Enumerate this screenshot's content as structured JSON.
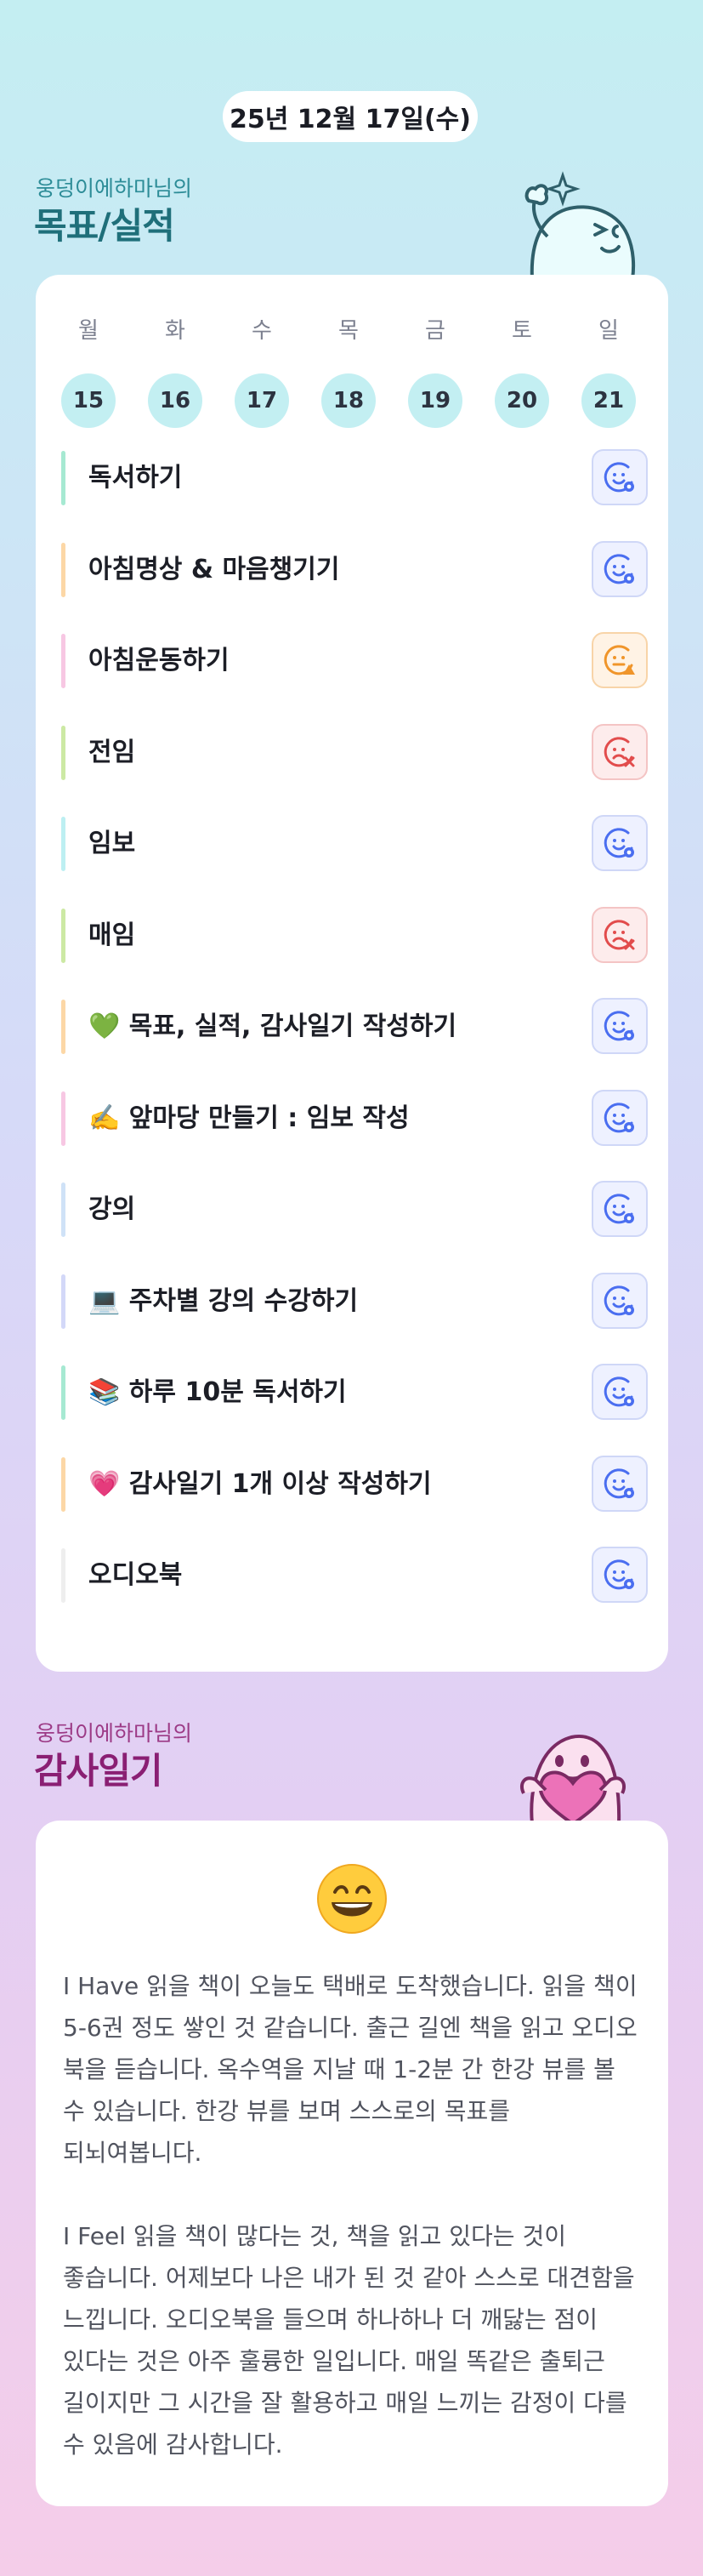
{
  "header": {
    "date": "25년 12월 17일(수)"
  },
  "goals_section": {
    "owner": "웅덩이에하마님의",
    "title": "목표/실적"
  },
  "week": {
    "days": [
      {
        "name": "월",
        "num": "15"
      },
      {
        "name": "화",
        "num": "16"
      },
      {
        "name": "수",
        "num": "17"
      },
      {
        "name": "목",
        "num": "18"
      },
      {
        "name": "금",
        "num": "19"
      },
      {
        "name": "토",
        "num": "20"
      },
      {
        "name": "일",
        "num": "21"
      }
    ]
  },
  "goals": [
    {
      "label": "독서하기",
      "bar_color": "#a6e9d2",
      "status": "ok"
    },
    {
      "label": "아침명상 & 마음챙기기",
      "bar_color": "#fcd7a6",
      "status": "ok"
    },
    {
      "label": "아침운동하기",
      "bar_color": "#f7c7e3",
      "status": "warn"
    },
    {
      "label": "전임",
      "bar_color": "#cce9a4",
      "status": "bad"
    },
    {
      "label": "임보",
      "bar_color": "#bdeff2",
      "status": "ok"
    },
    {
      "label": "매임",
      "bar_color": "#cce9a4",
      "status": "bad"
    },
    {
      "label": "💚 목표, 실적, 감사일기 작성하기",
      "bar_color": "#fcd7a6",
      "status": "ok"
    },
    {
      "label": "✍️ 앞마당 만들기 : 임보 작성",
      "bar_color": "#f7c7e3",
      "status": "ok"
    },
    {
      "label": "강의",
      "bar_color": "#cfe2f7",
      "status": "ok"
    },
    {
      "label": "💻 주차별 강의 수강하기",
      "bar_color": "#d3d8f8",
      "status": "ok"
    },
    {
      "label": "📚 하루 10분 독서하기",
      "bar_color": "#a6e9d2",
      "status": "ok"
    },
    {
      "label": "💗 감사일기 1개 이상 작성하기",
      "bar_color": "#fcd7a6",
      "status": "ok"
    },
    {
      "label": "오디오북",
      "bar_color": "#eeeeee",
      "status": "ok"
    }
  ],
  "status_icons": {
    "ok": "smile-check-icon",
    "warn": "warning-face-icon",
    "bad": "sad-x-icon"
  },
  "status_colors": {
    "ok": "#4a6ef0",
    "warn": "#f0952a",
    "bad": "#e24c4c"
  },
  "diary_section": {
    "owner": "웅덩이에하마님의",
    "title": "감사일기"
  },
  "diary": {
    "mood_icon": "grinning-face-icon",
    "text": "I Have 읽을 책이 오늘도 택배로 도착했습니다. 읽을 책이 5-6권 정도 쌓인 것 같습니다. 출근 길엔 책을 읽고 오디오 북을 듣습니다. 옥수역을 지날 때 1-2분 간 한강 뷰를 볼 수 있습니다. 한강 뷰를 보며 스스로의 목표를 되뇌여봅니다.\n\nI Feel 읽을 책이 많다는 것, 책을 읽고 있다는 것이 좋습니다. 어제보다 나은 내가 된 것 같아 스스로 대견함을 느낍니다. 오디오북을 들으며 하나하나 더 깨닳는 점이 있다는 것은 아주 훌륭한 일입니다. 매일 똑같은 출퇴근 길이지만 그 시간을 잘 활용하고 매일 느끼는 감정이 다를 수 있음에 감사합니다."
  }
}
